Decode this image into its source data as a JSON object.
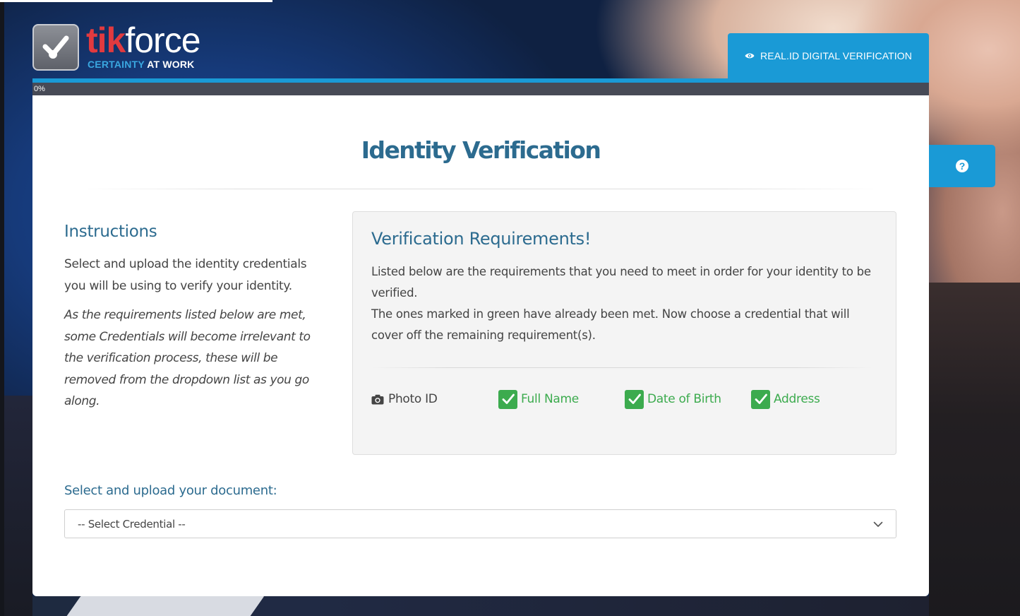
{
  "brand": {
    "name_part1": "tik",
    "name_part2": "force",
    "tagline_part1": "CERTAINTY",
    "tagline_part2": "AT WORK",
    "accent_color": "#1a9ad6",
    "brand_red": "#e23a3f"
  },
  "header": {
    "tab_label": "REAL.ID DIGITAL VERIFICATION",
    "tab_icon": "eye-icon"
  },
  "progress": {
    "label": "0%",
    "value": 0
  },
  "help": {
    "icon": "question-circle-icon",
    "glyph": "?"
  },
  "main": {
    "title": "Identity Verification",
    "instructions": {
      "heading": "Instructions",
      "body": "Select and upload the identity credentials you will be using to verify your identity.",
      "note": "As the requirements listed below are met, some Credentials will become irrelevant to the verification process, these will be removed from the dropdown list as you go along."
    },
    "requirements": {
      "heading": "Verification Requirements!",
      "line1": "Listed below are the requirements that you need to meet in order for your identity to be verified.",
      "line2": "The ones marked in green have already been met. Now choose a credential that will cover off the remaining requirement(s).",
      "items": [
        {
          "label": "Photo ID",
          "met": false,
          "icon": "camera-icon"
        },
        {
          "label": "Full Name",
          "met": true,
          "icon": "check-icon"
        },
        {
          "label": "Date of Birth",
          "met": true,
          "icon": "check-icon"
        },
        {
          "label": "Address",
          "met": true,
          "icon": "check-icon"
        }
      ],
      "met_color": "#3cab4e"
    },
    "upload": {
      "label": "Select and upload your document:",
      "select_value": "-- Select Credential --"
    }
  }
}
